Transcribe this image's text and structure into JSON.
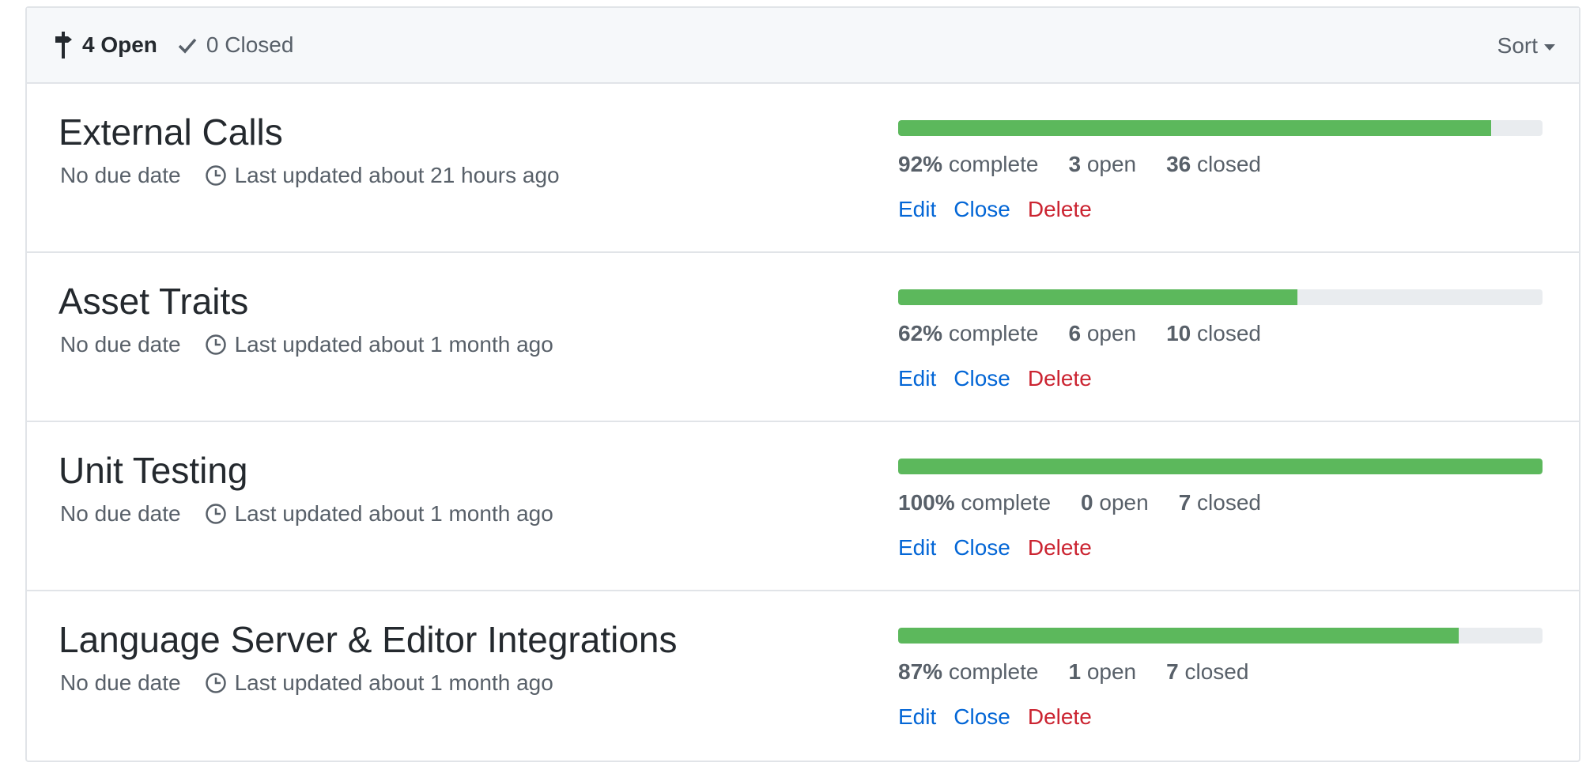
{
  "header": {
    "open_count": "4 Open",
    "closed_count": "0 Closed",
    "sort_label": "Sort"
  },
  "milestones": [
    {
      "title": "External Calls",
      "due": "No due date",
      "updated": "Last updated about 21 hours ago",
      "percent": "92%",
      "complete_label": "complete",
      "open_num": "3",
      "open_label": "open",
      "closed_num": "36",
      "closed_label": "closed",
      "progress": 0.92,
      "edit": "Edit",
      "close": "Close",
      "delete": "Delete"
    },
    {
      "title": "Asset Traits",
      "due": "No due date",
      "updated": "Last updated about 1 month ago",
      "percent": "62%",
      "complete_label": "complete",
      "open_num": "6",
      "open_label": "open",
      "closed_num": "10",
      "closed_label": "closed",
      "progress": 0.62,
      "edit": "Edit",
      "close": "Close",
      "delete": "Delete"
    },
    {
      "title": "Unit Testing",
      "due": "No due date",
      "updated": "Last updated about 1 month ago",
      "percent": "100%",
      "complete_label": "complete",
      "open_num": "0",
      "open_label": "open",
      "closed_num": "7",
      "closed_label": "closed",
      "progress": 1.0,
      "edit": "Edit",
      "close": "Close",
      "delete": "Delete"
    },
    {
      "title": "Language Server & Editor Integrations",
      "due": "No due date",
      "updated": "Last updated about 1 month ago",
      "percent": "87%",
      "complete_label": "complete",
      "open_num": "1",
      "open_label": "open",
      "closed_num": "7",
      "closed_label": "closed",
      "progress": 0.87,
      "edit": "Edit",
      "close": "Close",
      "delete": "Delete"
    }
  ],
  "colors": {
    "progress_fill": "#5cb85c",
    "progress_track": "#e9ecef",
    "link": "#0366d6",
    "danger": "#cb2431"
  },
  "icons": {
    "open": "milestone-icon",
    "closed": "check-icon",
    "updated": "clock-icon",
    "sort": "triangle-down-icon"
  }
}
